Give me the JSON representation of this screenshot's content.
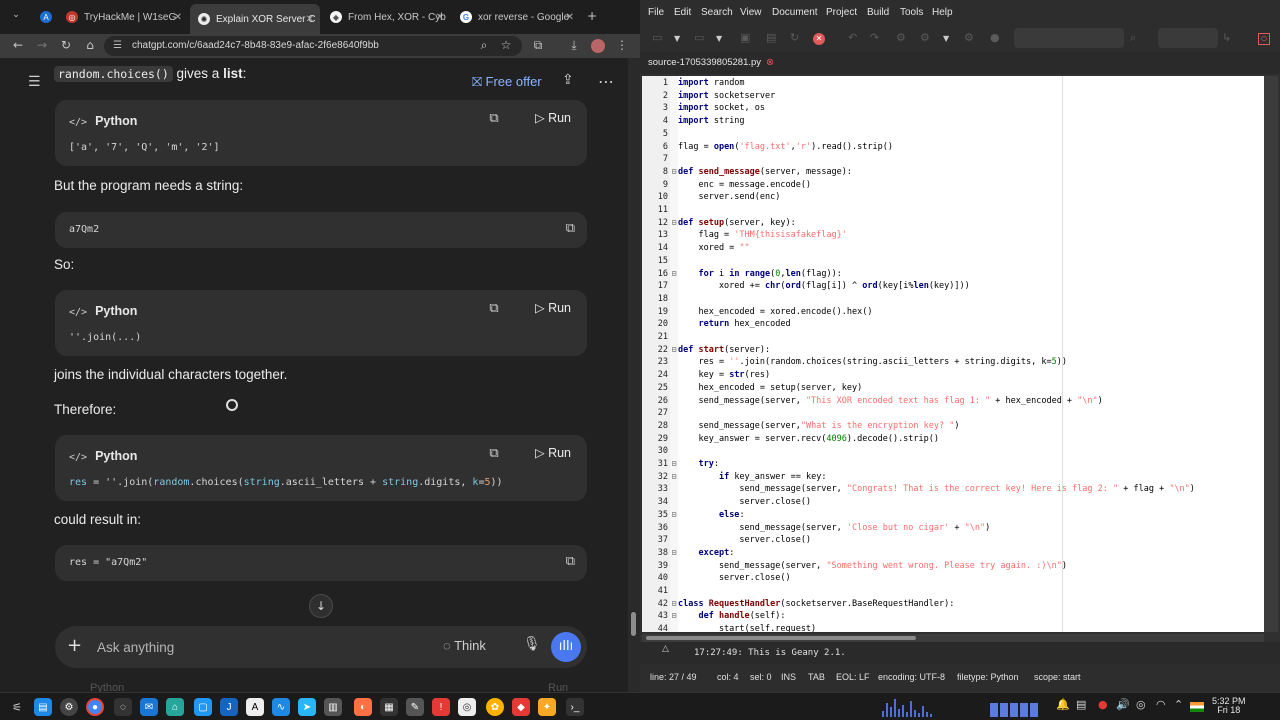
{
  "browser": {
    "tabs": [
      {
        "label": "TryHackMe | W1seG"
      },
      {
        "label": "Explain XOR Server C"
      },
      {
        "label": "From Hex, XOR - Cyb"
      },
      {
        "label": "xor reverse - Google"
      }
    ],
    "new_tab_icon": "plus-icon",
    "url": "chatgpt.com/c/6aad24c7-8b48-83e9-afac-2f6e8640f9bb"
  },
  "chat": {
    "free_offer": "Free offer",
    "para_top_code": "random.choices()",
    "para_top_text": " gives a ",
    "para_top_bold": "list",
    "para_top_end": ":",
    "code1_lang": "Python",
    "code1_run": "Run",
    "code1_line": "['a', '7', 'Q', 'm', '2']",
    "para2": "But the program needs a string:",
    "code2_line": "a7Qm2",
    "para3": "So:",
    "code3_lang": "Python",
    "code3_run": "Run",
    "code3_line": "''.join(...)",
    "para4": "joins the individual characters together.",
    "para5": "Therefore:",
    "code4_lang": "Python",
    "code4_run": "Run",
    "code4_res": "res",
    "code4_eq": " = ''.join(",
    "code4_random": "random",
    "code4_choices": ".choices(",
    "code4_string1": "string",
    "code4_letters": ".ascii_letters + ",
    "code4_string2": "string",
    "code4_digits": ".digits, ",
    "code4_k": "k",
    "code4_eq2": "=",
    "code4_five": "5",
    "code4_close": "))",
    "para6": "could result in:",
    "code5_line": "res = \"a7Qm2\"",
    "peek_lang": "Python",
    "peek_run": "Run",
    "composer_placeholder": "Ask anything",
    "think": "Think"
  },
  "geany": {
    "menu": [
      "File",
      "Edit",
      "Search",
      "View",
      "Document",
      "Project",
      "Build",
      "Tools",
      "Help"
    ],
    "doc_tab": "source-1705339805281.py",
    "lines": [
      "import random",
      "import socketserver",
      "import socket, os",
      "import string",
      "",
      "flag = open('flag.txt','r').read().strip()",
      "",
      "def send_message(server, message):",
      "    enc = message.encode()",
      "    server.send(enc)",
      "",
      "def setup(server, key):",
      "    flag = 'THM{thisisafakeflag}'",
      "    xored = \"\"",
      "",
      "    for i in range(0,len(flag)):",
      "        xored += chr(ord(flag[i]) ^ ord(key[i%len(key)]))",
      "",
      "    hex_encoded = xored.encode().hex()",
      "    return hex_encoded",
      "",
      "def start(server):",
      "    res = ''.join(random.choices(string.ascii_letters + string.digits, k=5))",
      "    key = str(res)",
      "    hex_encoded = setup(server, key)",
      "    send_message(server, \"This XOR encoded text has flag 1: \" + hex_encoded + \"\\n\")",
      "",
      "    send_message(server,\"What is the encryption key? \")",
      "    key_answer = server.recv(4096).decode().strip()",
      "",
      "    try:",
      "        if key_answer == key:",
      "            send_message(server, \"Congrats! That is the correct key! Here is flag 2: \" + flag + \"\\n\")",
      "            server.close()",
      "        else:",
      "            send_message(server, 'Close but no cigar' + \"\\n\")",
      "            server.close()",
      "    except:",
      "        send_message(server, \"Something went wrong. Please try again. :)\\n\")",
      "        server.close()",
      "",
      "class RequestHandler(socketserver.BaseRequestHandler):",
      "    def handle(self):",
      "        start(self.request)"
    ],
    "message": "17:27:49: This is Geany 2.1.",
    "status": {
      "line": "line: 27 / 49",
      "col": "col: 4",
      "sel": "sel: 0",
      "ins": "INS",
      "tab": "TAB",
      "eol": "EOL: LF",
      "encoding": "encoding: UTF-8",
      "filetype": "filetype: Python",
      "scope": "scope: start"
    }
  },
  "taskbar": {
    "time": "5:32 PM",
    "date": "Fri 18"
  }
}
